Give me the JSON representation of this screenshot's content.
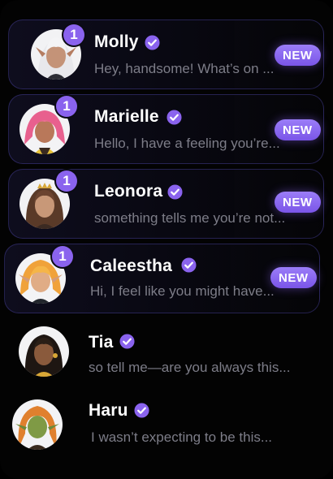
{
  "accent_color": "#8a63ee",
  "chats": [
    {
      "name": "Molly",
      "verified_icon": "check-badge-icon",
      "unread": "1",
      "badge": "NEW",
      "preview": "Hey, handsome! What’s on ..."
    },
    {
      "name": "Marielle",
      "verified_icon": "check-badge-icon",
      "unread": "1",
      "badge": "NEW",
      "preview": "Hello, I have a feeling you’re..."
    },
    {
      "name": "Leonora",
      "verified_icon": "check-badge-icon",
      "unread": "1",
      "badge": "NEW",
      "preview": "something tells me you’re not..."
    },
    {
      "name": "Caleestha",
      "verified_icon": "check-badge-icon",
      "unread": "1",
      "badge": "NEW",
      "preview": "Hi, I feel like you might have..."
    },
    {
      "name": "Tia",
      "verified_icon": "check-badge-icon",
      "preview": "so tell me—are you always this..."
    },
    {
      "name": "Haru",
      "verified_icon": "check-badge-icon",
      "preview": "I wasn’t expecting to be this..."
    }
  ]
}
